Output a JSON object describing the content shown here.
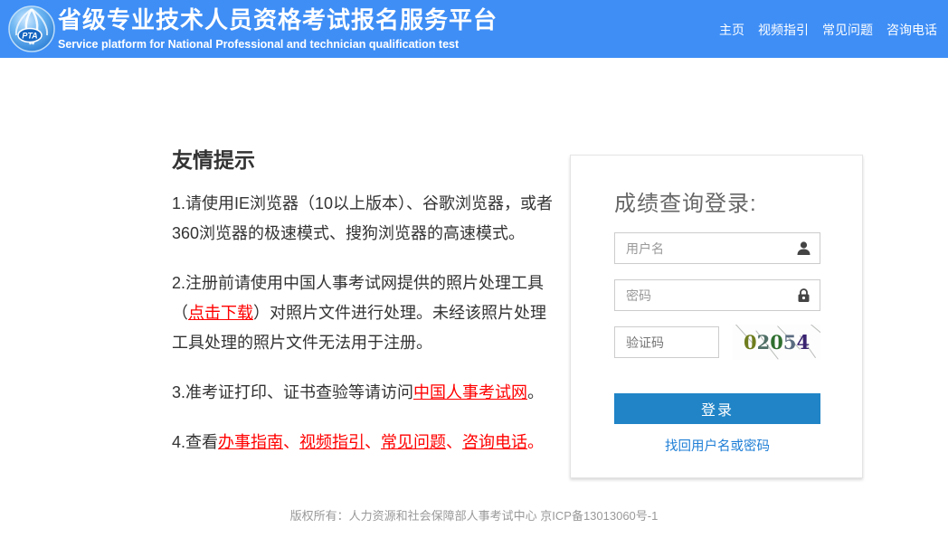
{
  "header": {
    "logo": "PTA",
    "title": "省级专业技术人员资格考试报名服务平台",
    "subtitle": "Service platform for National Professional and technician qualification test",
    "nav": [
      "主页",
      "视频指引",
      "常见问题",
      "咨询电话"
    ]
  },
  "tips": {
    "heading": "友情提示",
    "item1": "1.请使用IE浏览器（10以上版本）、谷歌浏览器，或者360浏览器的极速模式、搜狗浏览器的高速模式。",
    "item2": {
      "pre": "2.注册前请使用中国人事考试网提供的照片处理工具（",
      "link": "点击下载",
      "post": "）对照片文件进行处理。未经该照片处理工具处理的照片文件无法用于注册。"
    },
    "item3": {
      "pre": "3.准考证打印、证书查验等请访问",
      "link": "中国人事考试网",
      "post": "。"
    },
    "item4": {
      "pre": "4.查看",
      "links": [
        "办事指南",
        "视频指引",
        "常见问题",
        "咨询电话"
      ],
      "separator": "、",
      "post": "。"
    }
  },
  "login": {
    "title": "成绩查询登录:",
    "username_placeholder": "用户名",
    "password_placeholder": "密码",
    "captcha_placeholder": "验证码",
    "captcha_code": "02054",
    "captcha_digits": [
      "0",
      "2",
      "0",
      "5",
      "4"
    ],
    "button": "登录",
    "forgot": "找回用户名或密码"
  },
  "footer": "版权所有：人力资源和社会保障部人事考试中心 京ICP备13013060号-1",
  "colors": {
    "header_blue": "#3e8ef6",
    "button_blue": "#2084c7",
    "link_blue": "#1e7ed6",
    "link_red": "#ff0000",
    "captcha_digit_colors": [
      "#6f7d1f",
      "#4f6f66",
      "#2f6f2f",
      "#5a6b80",
      "#3a2370"
    ]
  }
}
